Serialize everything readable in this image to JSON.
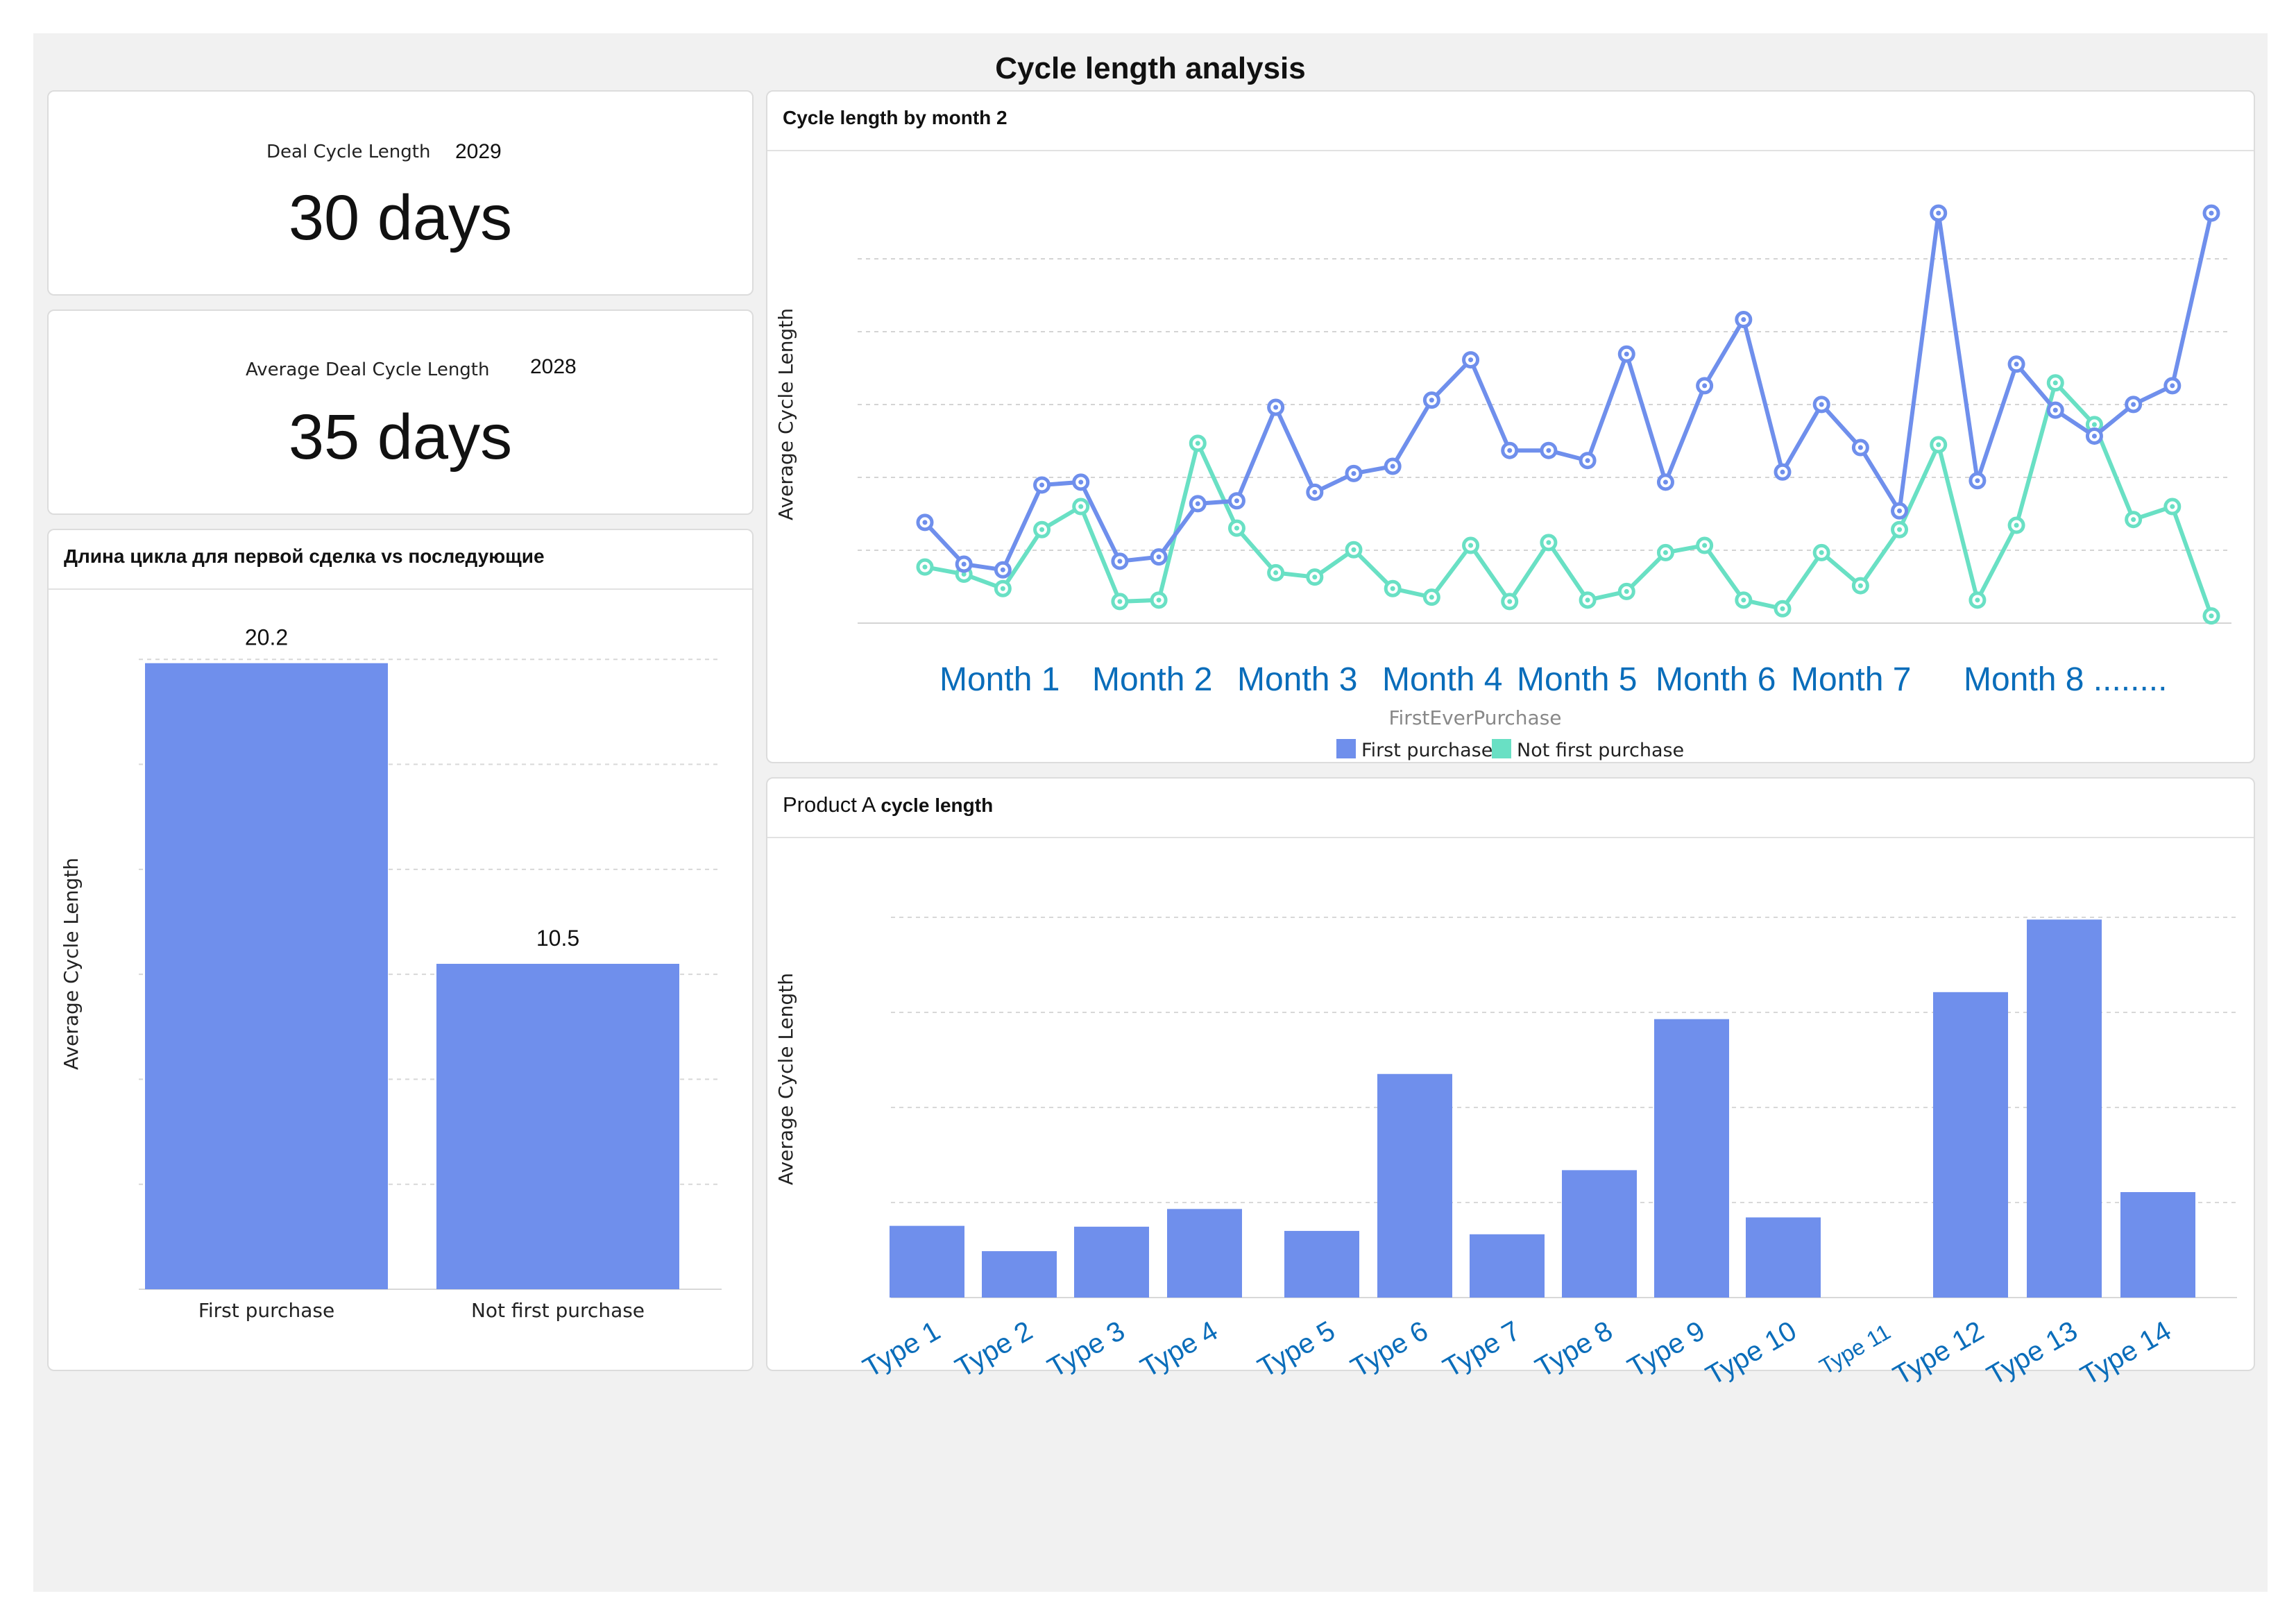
{
  "dashboard": {
    "title": "Cycle length analysis"
  },
  "kpi1": {
    "label": "Deal Cycle Length",
    "year": "2029",
    "value": "30 days"
  },
  "kpi2": {
    "label": "Average Deal Cycle Length",
    "year": "2028",
    "value": "35 days"
  },
  "panels": {
    "first_vs_repeat": "Длина цикла для первой сделка vs последующие",
    "by_month": "Cycle length by month 2",
    "product_prefix": "Product A",
    "product_suffix": "cycle length"
  },
  "colors": {
    "blue": "#6f8fec",
    "teal": "#69e0c4",
    "axis_blue": "#0a6dba",
    "accent_text": "#111111"
  },
  "chart_data": [
    {
      "id": "first_vs_repeat",
      "type": "bar",
      "categories": [
        "First purchase",
        "Not first purchase"
      ],
      "values": [
        20.2,
        10.5
      ],
      "data_labels": [
        "20.2",
        "10.5"
      ],
      "ylabel": "Average Cycle Length",
      "ylim": [
        0,
        21
      ],
      "grid": true
    },
    {
      "id": "by_month",
      "type": "line",
      "x_labels": [
        "Month 1",
        "Month 2",
        "Month 3",
        "Month 4",
        "Month 5",
        "Month 6",
        "Month 7",
        "Month 8 ........"
      ],
      "xlabel": "FirstEverPurchase",
      "ylabel": "Average Cycle Length",
      "ylim": [
        0,
        6
      ],
      "grid": true,
      "legend": "bottom-center",
      "series": [
        {
          "name": "First purchase",
          "values": [
            1.4,
            0.82,
            0.74,
            1.92,
            1.96,
            0.86,
            0.92,
            1.66,
            1.7,
            3.0,
            1.82,
            2.08,
            2.18,
            3.1,
            3.66,
            2.4,
            2.4,
            2.26,
            3.74,
            1.96,
            3.3,
            4.22,
            2.1,
            3.04,
            2.44,
            1.56,
            5.7,
            1.98,
            3.6,
            2.96,
            2.6,
            3.04,
            3.3,
            5.7
          ]
        },
        {
          "name": "Not first purchase",
          "values": [
            0.78,
            0.68,
            0.48,
            1.3,
            1.62,
            0.3,
            0.32,
            2.5,
            1.32,
            0.7,
            0.64,
            1.02,
            0.48,
            0.36,
            1.08,
            0.3,
            1.12,
            0.32,
            0.44,
            0.98,
            1.08,
            0.32,
            0.2,
            0.98,
            0.52,
            1.3,
            2.48,
            0.32,
            1.36,
            3.34,
            2.76,
            1.44,
            1.62,
            0.1
          ]
        }
      ]
    },
    {
      "id": "product_a",
      "type": "bar",
      "categories": [
        "Type 1",
        "Type 2",
        "Type 3",
        "Type 4",
        "Type 5",
        "Type 6",
        "Type 7",
        "Type 8",
        "Type 9",
        "Type 10",
        "Type 11",
        "Type 12",
        "Type 13",
        "Type 14"
      ],
      "values": [
        0.85,
        0.55,
        0.84,
        1.05,
        0.79,
        2.65,
        0.75,
        1.51,
        3.3,
        0.95,
        0,
        3.62,
        4.48,
        1.25
      ],
      "ylabel": "Average Cycle Length",
      "ylim": [
        0,
        5
      ],
      "grid": true
    }
  ]
}
